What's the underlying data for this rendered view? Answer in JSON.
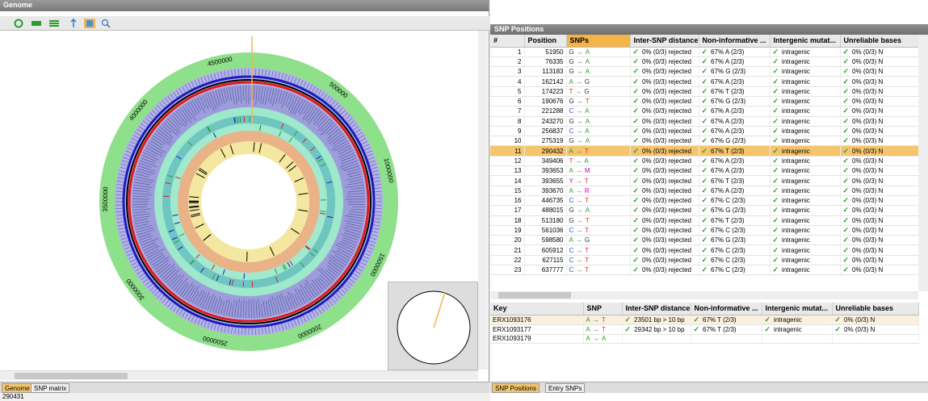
{
  "left_panel": {
    "title": "Genome",
    "tabs": [
      "Genome",
      "SNP matrix"
    ],
    "status_value": "290431",
    "genome_labels": [
      "500000",
      "1000000",
      "1500000",
      "2000000",
      "2500000",
      "3000000",
      "3500000",
      "4000000",
      "4500000"
    ]
  },
  "right_panel": {
    "title": "SNP Positions",
    "columns": [
      "#",
      "Position",
      "SNPs",
      "Inter-SNP distance",
      "Non-informative ...",
      "Intergenic mutat...",
      "Unreliable bases"
    ],
    "rows": [
      {
        "n": "1",
        "pos": "51950",
        "ref": "G",
        "alt": "A",
        "dist": "0% (0/3) rejected",
        "noninf": "67% A (2/3)",
        "inter": "intragenic",
        "unrel": "0% (0/3) N"
      },
      {
        "n": "2",
        "pos": "76335",
        "ref": "G",
        "alt": "A",
        "dist": "0% (0/3) rejected",
        "noninf": "67% A (2/3)",
        "inter": "intragenic",
        "unrel": "0% (0/3) N"
      },
      {
        "n": "3",
        "pos": "113183",
        "ref": "G",
        "alt": "A",
        "dist": "0% (0/3) rejected",
        "noninf": "67% G (2/3)",
        "inter": "intragenic",
        "unrel": "0% (0/3) N"
      },
      {
        "n": "4",
        "pos": "162142",
        "ref": "A",
        "alt": "G",
        "dist": "0% (0/3) rejected",
        "noninf": "67% A (2/3)",
        "inter": "intragenic",
        "unrel": "0% (0/3) N"
      },
      {
        "n": "5",
        "pos": "174223",
        "ref": "T",
        "alt": "G",
        "dist": "0% (0/3) rejected",
        "noninf": "67% T (2/3)",
        "inter": "intragenic",
        "unrel": "0% (0/3) N"
      },
      {
        "n": "6",
        "pos": "190676",
        "ref": "G",
        "alt": "T",
        "dist": "0% (0/3) rejected",
        "noninf": "67% G (2/3)",
        "inter": "intragenic",
        "unrel": "0% (0/3) N"
      },
      {
        "n": "7",
        "pos": "221288",
        "ref": "C",
        "alt": "A",
        "dist": "0% (0/3) rejected",
        "noninf": "67% A (2/3)",
        "inter": "intragenic",
        "unrel": "0% (0/3) N"
      },
      {
        "n": "8",
        "pos": "243270",
        "ref": "G",
        "alt": "A",
        "dist": "0% (0/3) rejected",
        "noninf": "67% A (2/3)",
        "inter": "intragenic",
        "unrel": "0% (0/3) N"
      },
      {
        "n": "9",
        "pos": "256837",
        "ref": "C",
        "alt": "A",
        "dist": "0% (0/3) rejected",
        "noninf": "67% A (2/3)",
        "inter": "intragenic",
        "unrel": "0% (0/3) N"
      },
      {
        "n": "10",
        "pos": "275319",
        "ref": "G",
        "alt": "A",
        "dist": "0% (0/3) rejected",
        "noninf": "67% G (2/3)",
        "inter": "intragenic",
        "unrel": "0% (0/3) N"
      },
      {
        "n": "11",
        "pos": "290432",
        "ref": "A",
        "alt": "T",
        "dist": "0% (0/3) rejected",
        "noninf": "67% T (2/3)",
        "inter": "intragenic",
        "unrel": "0% (0/3) N",
        "selected": true
      },
      {
        "n": "12",
        "pos": "349406",
        "ref": "T",
        "alt": "A",
        "dist": "0% (0/3) rejected",
        "noninf": "67% A (2/3)",
        "inter": "intragenic",
        "unrel": "0% (0/3) N"
      },
      {
        "n": "13",
        "pos": "393653",
        "ref": "A",
        "alt": "M",
        "dist": "0% (0/3) rejected",
        "noninf": "67% A (2/3)",
        "inter": "intragenic",
        "unrel": "0% (0/3) N"
      },
      {
        "n": "14",
        "pos": "393655",
        "ref": "Y",
        "alt": "T",
        "dist": "0% (0/3) rejected",
        "noninf": "67% T (2/3)",
        "inter": "intragenic",
        "unrel": "0% (0/3) N"
      },
      {
        "n": "15",
        "pos": "393670",
        "ref": "A",
        "alt": "R",
        "dist": "0% (0/3) rejected",
        "noninf": "67% A (2/3)",
        "inter": "intragenic",
        "unrel": "0% (0/3) N"
      },
      {
        "n": "16",
        "pos": "446735",
        "ref": "C",
        "alt": "T",
        "dist": "0% (0/3) rejected",
        "noninf": "67% C (2/3)",
        "inter": "intragenic",
        "unrel": "0% (0/3) N"
      },
      {
        "n": "17",
        "pos": "488015",
        "ref": "G",
        "alt": "A",
        "dist": "0% (0/3) rejected",
        "noninf": "67% G (2/3)",
        "inter": "intragenic",
        "unrel": "0% (0/3) N"
      },
      {
        "n": "18",
        "pos": "513180",
        "ref": "G",
        "alt": "T",
        "dist": "0% (0/3) rejected",
        "noninf": "67% T (2/3)",
        "inter": "intragenic",
        "unrel": "0% (0/3) N"
      },
      {
        "n": "19",
        "pos": "561036",
        "ref": "C",
        "alt": "T",
        "dist": "0% (0/3) rejected",
        "noninf": "67% C (2/3)",
        "inter": "intragenic",
        "unrel": "0% (0/3) N"
      },
      {
        "n": "20",
        "pos": "598580",
        "ref": "A",
        "alt": "G",
        "dist": "0% (0/3) rejected",
        "noninf": "67% G (2/3)",
        "inter": "intragenic",
        "unrel": "0% (0/3) N"
      },
      {
        "n": "21",
        "pos": "605912",
        "ref": "C",
        "alt": "T",
        "dist": "0% (0/3) rejected",
        "noninf": "67% C (2/3)",
        "inter": "intragenic",
        "unrel": "0% (0/3) N"
      },
      {
        "n": "22",
        "pos": "627115",
        "ref": "C",
        "alt": "T",
        "dist": "0% (0/3) rejected",
        "noninf": "67% C (2/3)",
        "inter": "intragenic",
        "unrel": "0% (0/3) N"
      },
      {
        "n": "23",
        "pos": "637777",
        "ref": "C",
        "alt": "T",
        "dist": "0% (0/3) rejected",
        "noninf": "67% C (2/3)",
        "inter": "intragenic",
        "unrel": "0% (0/3) N"
      }
    ],
    "key_columns": [
      "Key",
      "SNP",
      "Inter-SNP distance",
      "Non-informative ...",
      "Intergenic mutat...",
      "Unreliable bases"
    ],
    "key_rows": [
      {
        "key": "ERX1093176",
        "ref": "A",
        "alt": "T",
        "dist": "23501 bp > 10 bp",
        "noninf": "67% T (2/3)",
        "inter": "intragenic",
        "unrel": "0% (0/3) N"
      },
      {
        "key": "ERX1093177",
        "ref": "A",
        "alt": "T",
        "dist": "29342 bp > 10 bp",
        "noninf": "67% T (2/3)",
        "inter": "intragenic",
        "unrel": "0% (0/3) N"
      },
      {
        "key": "ERX1093179",
        "ref": "A",
        "alt": "A",
        "dist": "",
        "noninf": "",
        "inter": "",
        "unrel": ""
      }
    ],
    "tabs": [
      "SNP Positions",
      "Entry SNPs"
    ]
  }
}
